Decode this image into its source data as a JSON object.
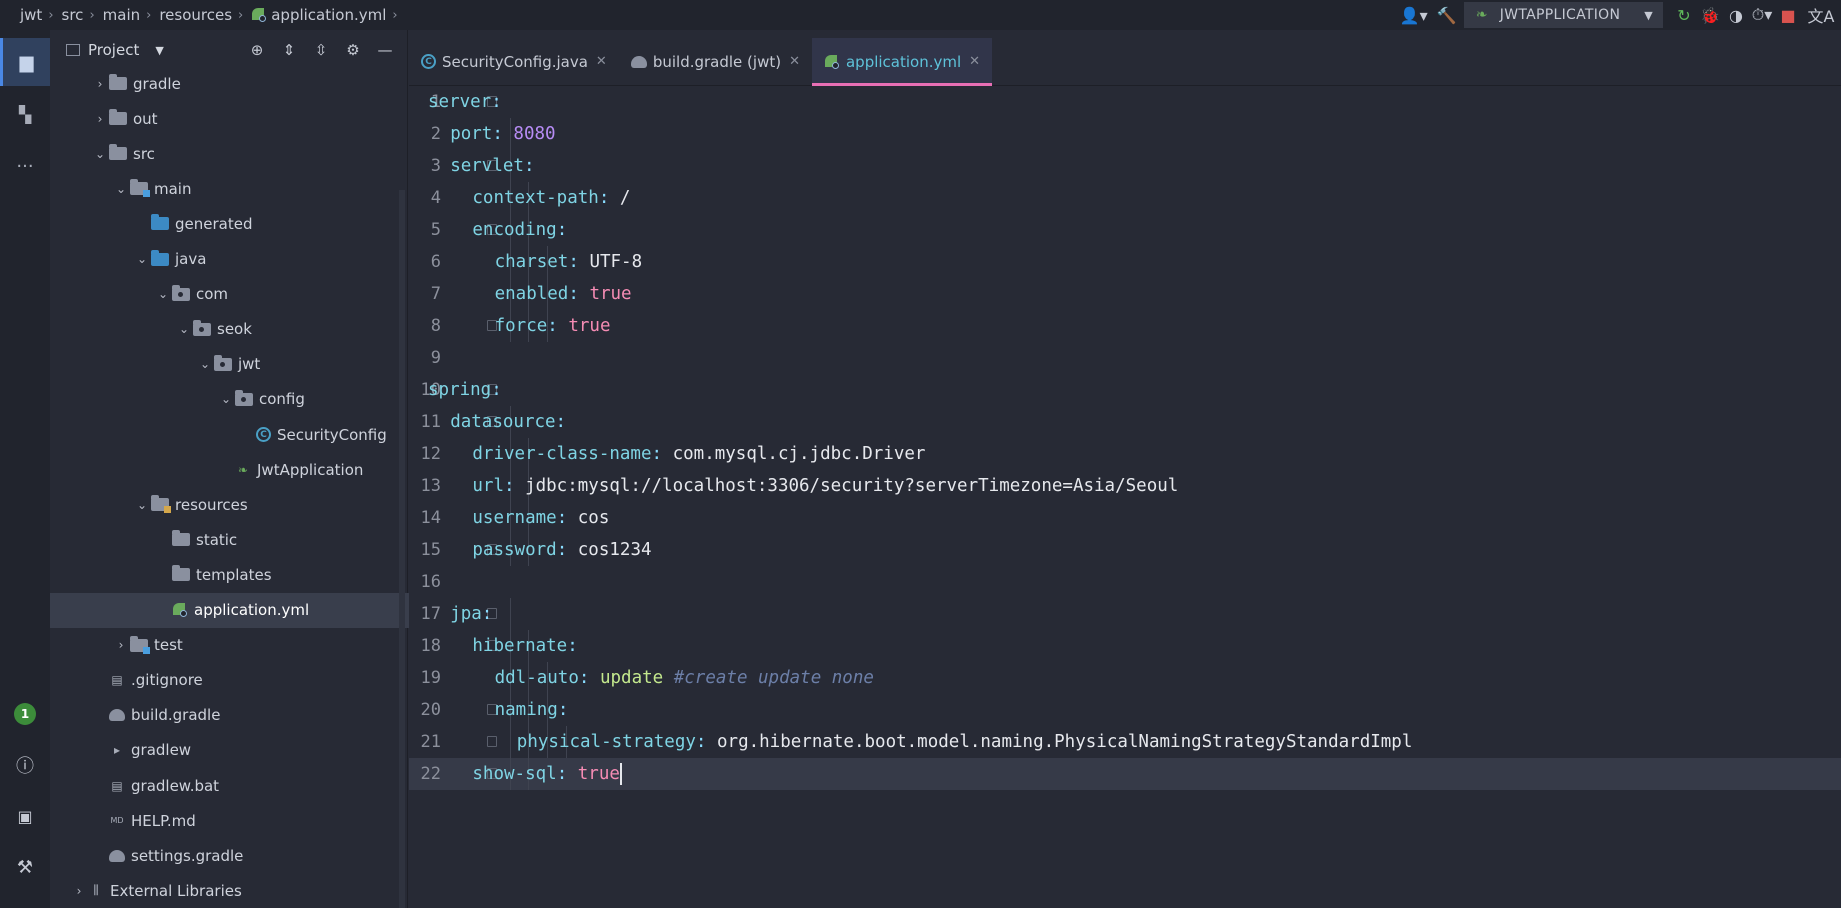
{
  "breadcrumbs": [
    "jwt",
    "src",
    "main",
    "resources",
    "application.yml"
  ],
  "toolbar": {
    "run_config": "JWTAPPLICATION"
  },
  "left_strip": {
    "badge": "1"
  },
  "project_panel": {
    "title": "Project",
    "tree": [
      {
        "label": "gradle",
        "kind": "folder",
        "depth": 1,
        "arrow": "›"
      },
      {
        "label": "out",
        "kind": "folder",
        "depth": 1,
        "arrow": "›"
      },
      {
        "label": "src",
        "kind": "folder",
        "depth": 1,
        "arrow": "⌄"
      },
      {
        "label": "main",
        "kind": "folder-src",
        "depth": 2,
        "arrow": "⌄"
      },
      {
        "label": "generated",
        "kind": "folder-gen",
        "depth": 3,
        "arrow": ""
      },
      {
        "label": "java",
        "kind": "folder-blue",
        "depth": 3,
        "arrow": "⌄"
      },
      {
        "label": "com",
        "kind": "folder-pkg",
        "depth": 4,
        "arrow": "⌄"
      },
      {
        "label": "seok",
        "kind": "folder-pkg",
        "depth": 5,
        "arrow": "⌄"
      },
      {
        "label": "jwt",
        "kind": "folder-pkg",
        "depth": 6,
        "arrow": "⌄"
      },
      {
        "label": "config",
        "kind": "folder-pkg",
        "depth": 7,
        "arrow": "⌄"
      },
      {
        "label": "SecurityConfig",
        "kind": "class",
        "depth": 8,
        "arrow": ""
      },
      {
        "label": "JwtApplication",
        "kind": "spring",
        "depth": 7,
        "arrow": ""
      },
      {
        "label": "resources",
        "kind": "folder-res",
        "depth": 3,
        "arrow": "⌄"
      },
      {
        "label": "static",
        "kind": "folder",
        "depth": 4,
        "arrow": ""
      },
      {
        "label": "templates",
        "kind": "folder",
        "depth": 4,
        "arrow": ""
      },
      {
        "label": "application.yml",
        "kind": "yml",
        "depth": 4,
        "arrow": "",
        "selected": true
      },
      {
        "label": "test",
        "kind": "folder-src",
        "depth": 2,
        "arrow": "›"
      },
      {
        "label": ".gitignore",
        "kind": "file",
        "depth": 1,
        "arrow": ""
      },
      {
        "label": "build.gradle",
        "kind": "gradle",
        "depth": 1,
        "arrow": ""
      },
      {
        "label": "gradlew",
        "kind": "term",
        "depth": 1,
        "arrow": ""
      },
      {
        "label": "gradlew.bat",
        "kind": "file",
        "depth": 1,
        "arrow": ""
      },
      {
        "label": "HELP.md",
        "kind": "md",
        "depth": 1,
        "arrow": ""
      },
      {
        "label": "settings.gradle",
        "kind": "gradle",
        "depth": 1,
        "arrow": ""
      },
      {
        "label": "External Libraries",
        "kind": "lib",
        "depth": 0,
        "arrow": "›"
      }
    ]
  },
  "tabs": [
    {
      "label": "SecurityConfig.java",
      "icon": "class-icon",
      "active": false
    },
    {
      "label": "build.gradle (jwt)",
      "icon": "gradle-icon",
      "active": false
    },
    {
      "label": "application.yml",
      "icon": "yml-icon",
      "active": true
    }
  ],
  "editor": {
    "current_line": 22,
    "lines": [
      {
        "n": "1",
        "indent": 0,
        "fold": true,
        "tokens": [
          [
            "k",
            "server"
          ],
          [
            "p",
            ":"
          ]
        ]
      },
      {
        "n": "2",
        "indent": 1,
        "fold": false,
        "tokens": [
          [
            "k",
            "port"
          ],
          [
            "p",
            ": "
          ],
          [
            "n",
            "8080"
          ]
        ]
      },
      {
        "n": "3",
        "indent": 1,
        "fold": true,
        "tokens": [
          [
            "k",
            "servlet"
          ],
          [
            "p",
            ":"
          ]
        ]
      },
      {
        "n": "4",
        "indent": 2,
        "fold": false,
        "tokens": [
          [
            "k",
            "context-path"
          ],
          [
            "p",
            ": "
          ],
          [
            "v",
            "/"
          ]
        ]
      },
      {
        "n": "5",
        "indent": 2,
        "fold": true,
        "tokens": [
          [
            "k",
            "encoding"
          ],
          [
            "p",
            ":"
          ]
        ]
      },
      {
        "n": "6",
        "indent": 3,
        "fold": false,
        "tokens": [
          [
            "k",
            "charset"
          ],
          [
            "p",
            ": "
          ],
          [
            "v",
            "UTF-8"
          ]
        ]
      },
      {
        "n": "7",
        "indent": 3,
        "fold": false,
        "tokens": [
          [
            "k",
            "enabled"
          ],
          [
            "p",
            ": "
          ],
          [
            "b",
            "true"
          ]
        ]
      },
      {
        "n": "8",
        "indent": 3,
        "fold": true,
        "tokens": [
          [
            "k",
            "force"
          ],
          [
            "p",
            ": "
          ],
          [
            "b",
            "true"
          ]
        ]
      },
      {
        "n": "9",
        "indent": 0,
        "fold": false,
        "tokens": []
      },
      {
        "n": "10",
        "indent": 0,
        "fold": true,
        "tokens": [
          [
            "k",
            "spring"
          ],
          [
            "p",
            ":"
          ]
        ]
      },
      {
        "n": "11",
        "indent": 1,
        "fold": true,
        "tokens": [
          [
            "k",
            "datasource"
          ],
          [
            "p",
            ":"
          ]
        ]
      },
      {
        "n": "12",
        "indent": 2,
        "fold": false,
        "tokens": [
          [
            "k",
            "driver-class-name"
          ],
          [
            "p",
            ": "
          ],
          [
            "v",
            "com.mysql.cj.jdbc.Driver"
          ]
        ]
      },
      {
        "n": "13",
        "indent": 2,
        "fold": false,
        "tokens": [
          [
            "k",
            "url"
          ],
          [
            "p",
            ": "
          ],
          [
            "v",
            "jdbc:mysql://localhost:3306/security?serverTimezone=Asia/Seoul"
          ]
        ]
      },
      {
        "n": "14",
        "indent": 2,
        "fold": false,
        "tokens": [
          [
            "k",
            "username"
          ],
          [
            "p",
            ": "
          ],
          [
            "v",
            "cos"
          ]
        ]
      },
      {
        "n": "15",
        "indent": 2,
        "fold": true,
        "tokens": [
          [
            "k",
            "password"
          ],
          [
            "p",
            ": "
          ],
          [
            "v",
            "cos1234"
          ]
        ]
      },
      {
        "n": "16",
        "indent": 0,
        "fold": false,
        "tokens": []
      },
      {
        "n": "17",
        "indent": 1,
        "fold": true,
        "tokens": [
          [
            "k",
            "jpa"
          ],
          [
            "p",
            ":"
          ]
        ]
      },
      {
        "n": "18",
        "indent": 2,
        "fold": true,
        "tokens": [
          [
            "k",
            "hibernate"
          ],
          [
            "p",
            ":"
          ]
        ]
      },
      {
        "n": "19",
        "indent": 3,
        "fold": false,
        "tokens": [
          [
            "k",
            "ddl-auto"
          ],
          [
            "p",
            ": "
          ],
          [
            "g",
            "update "
          ],
          [
            "c",
            "#create update none"
          ]
        ]
      },
      {
        "n": "20",
        "indent": 3,
        "fold": true,
        "tokens": [
          [
            "k",
            "naming"
          ],
          [
            "p",
            ":"
          ]
        ]
      },
      {
        "n": "21",
        "indent": 4,
        "fold": true,
        "tokens": [
          [
            "k",
            "physical-strategy"
          ],
          [
            "p",
            ": "
          ],
          [
            "v",
            "org.hibernate.boot.model.naming.PhysicalNamingStrategyStandardImpl"
          ]
        ]
      },
      {
        "n": "22",
        "indent": 2,
        "fold": true,
        "tokens": [
          [
            "k",
            "show-sql"
          ],
          [
            "p",
            ": "
          ],
          [
            "b",
            "true"
          ]
        ]
      }
    ]
  }
}
